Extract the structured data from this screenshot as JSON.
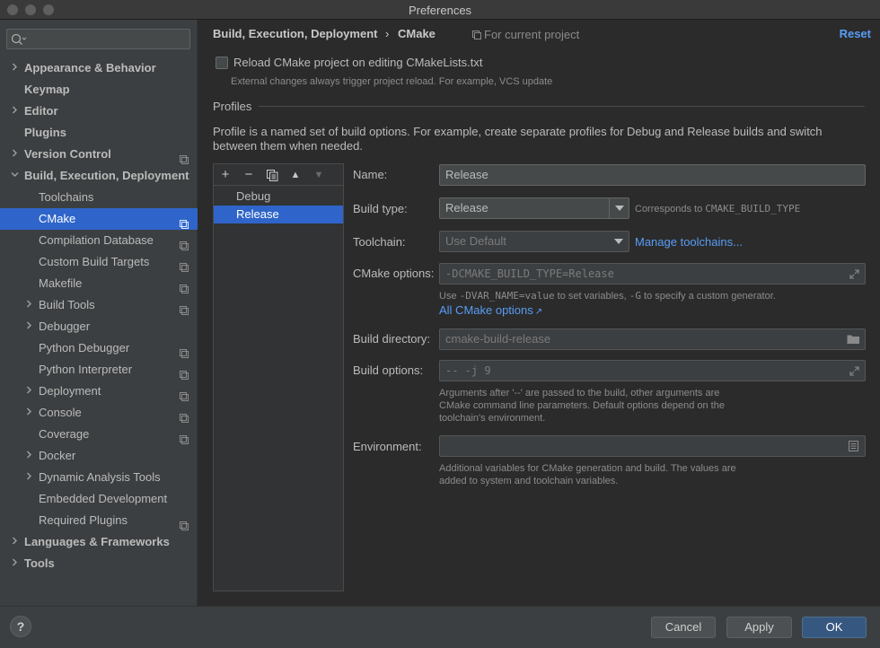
{
  "window": {
    "title": "Preferences"
  },
  "colors": {
    "accent": "#2f65ca",
    "link": "#589df6",
    "background": "#2b2b2b",
    "sidebar": "#3c3f41"
  },
  "sidebar": {
    "search_placeholder": "",
    "items": [
      {
        "label": "Appearance & Behavior",
        "bold": true,
        "chevron": "right",
        "project": false
      },
      {
        "label": "Keymap",
        "bold": true,
        "chevron": "",
        "project": false
      },
      {
        "label": "Editor",
        "bold": true,
        "chevron": "right",
        "project": false
      },
      {
        "label": "Plugins",
        "bold": true,
        "chevron": "",
        "project": false
      },
      {
        "label": "Version Control",
        "bold": true,
        "chevron": "right",
        "project": true
      },
      {
        "label": "Build, Execution, Deployment",
        "bold": true,
        "chevron": "down",
        "project": false
      },
      {
        "label": "Toolchains",
        "bold": false,
        "chevron": "",
        "project": false
      },
      {
        "label": "CMake",
        "bold": false,
        "chevron": "",
        "project": true,
        "selected": true
      },
      {
        "label": "Compilation Database",
        "bold": false,
        "chevron": "",
        "project": true
      },
      {
        "label": "Custom Build Targets",
        "bold": false,
        "chevron": "",
        "project": true
      },
      {
        "label": "Makefile",
        "bold": false,
        "chevron": "",
        "project": true
      },
      {
        "label": "Build Tools",
        "bold": false,
        "chevron": "right",
        "project": true
      },
      {
        "label": "Debugger",
        "bold": false,
        "chevron": "right",
        "project": false
      },
      {
        "label": "Python Debugger",
        "bold": false,
        "chevron": "",
        "project": true
      },
      {
        "label": "Python Interpreter",
        "bold": false,
        "chevron": "",
        "project": true
      },
      {
        "label": "Deployment",
        "bold": false,
        "chevron": "right",
        "project": true
      },
      {
        "label": "Console",
        "bold": false,
        "chevron": "right",
        "project": true
      },
      {
        "label": "Coverage",
        "bold": false,
        "chevron": "",
        "project": true
      },
      {
        "label": "Docker",
        "bold": false,
        "chevron": "right",
        "project": false
      },
      {
        "label": "Dynamic Analysis Tools",
        "bold": false,
        "chevron": "right",
        "project": false
      },
      {
        "label": "Embedded Development",
        "bold": false,
        "chevron": "",
        "project": false
      },
      {
        "label": "Required Plugins",
        "bold": false,
        "chevron": "",
        "project": true
      },
      {
        "label": "Languages & Frameworks",
        "bold": true,
        "chevron": "right",
        "project": false
      },
      {
        "label": "Tools",
        "bold": true,
        "chevron": "right",
        "project": false
      }
    ]
  },
  "header": {
    "breadcrumb_parent": "Build, Execution, Deployment",
    "breadcrumb_sep": "›",
    "breadcrumb_current": "CMake",
    "scope": "For current project",
    "reset": "Reset"
  },
  "reload": {
    "label": "Reload CMake project on editing CMakeLists.txt",
    "checked": false,
    "hint": "External changes always trigger project reload. For example, VCS update"
  },
  "profiles": {
    "title": "Profiles",
    "description": "Profile is a named set of build options. For example, create separate profiles for Debug and Release builds and switch between them when needed.",
    "toolbar": {
      "add": "+",
      "remove": "−",
      "copy": "copy-icon",
      "up": "▲",
      "down": "▼"
    },
    "list": [
      "Debug",
      "Release"
    ],
    "selected": "Release"
  },
  "form": {
    "name_label": "Name:",
    "name_value": "Release",
    "build_type_label": "Build type:",
    "build_type_value": "Release",
    "build_type_hint_prefix": "Corresponds to ",
    "build_type_hint_code": "CMAKE_BUILD_TYPE",
    "toolchain_label": "Toolchain:",
    "toolchain_value": "Use Default",
    "manage_toolchains": "Manage toolchains...",
    "cmake_options_label": "CMake options:",
    "cmake_options_value": "-DCMAKE_BUILD_TYPE=Release",
    "cmake_hint_1": "Use ",
    "cmake_hint_code1": "-DVAR_NAME=value",
    "cmake_hint_2": " to set variables, ",
    "cmake_hint_code2": "-G",
    "cmake_hint_3": " to specify a custom generator.",
    "all_cmake_options": "All CMake options",
    "all_cmake_options_arrow": "↗",
    "build_dir_label": "Build directory:",
    "build_dir_value": "cmake-build-release",
    "build_options_label": "Build options:",
    "build_options_value": "-- -j 9",
    "build_options_hint_1": "Arguments after '--' are passed to the build, other arguments are",
    "build_options_hint_2": "CMake command line parameters. Default options depend on the",
    "build_options_hint_3": "toolchain's environment.",
    "env_label": "Environment:",
    "env_value": "",
    "env_hint_1": "Additional variables for CMake generation and build. The values are",
    "env_hint_2": "added to system and toolchain variables."
  },
  "footer": {
    "help": "?",
    "cancel": "Cancel",
    "apply": "Apply",
    "ok": "OK"
  }
}
